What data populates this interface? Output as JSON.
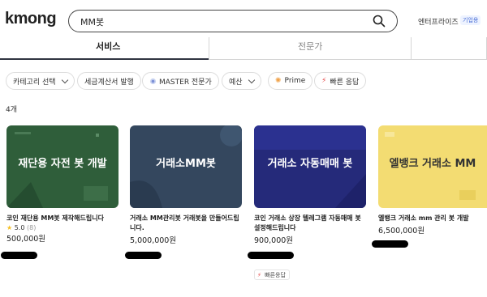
{
  "header": {
    "logo": "kmong",
    "search_value": "MM봇",
    "enterprise_label": "엔터프라이즈",
    "enterprise_badge": "기업용"
  },
  "tabs": [
    {
      "label": "서비스",
      "active": true
    },
    {
      "label": "전문가",
      "active": false
    }
  ],
  "filters": [
    {
      "label": "카테고리 선택",
      "icon": "",
      "dropdown": true
    },
    {
      "label": "세금계산서 발행",
      "icon": "",
      "dropdown": false
    },
    {
      "label": "MASTER 전문가",
      "icon": "master-icon",
      "dropdown": false
    },
    {
      "label": "예산",
      "icon": "",
      "dropdown": true
    },
    {
      "label": "Prime",
      "icon": "prime-icon",
      "dropdown": false
    },
    {
      "label": "빠른 응답",
      "icon": "lightning-icon",
      "dropdown": false
    }
  ],
  "result_count": "4개",
  "cards": [
    {
      "thumb_text": "재단용 자전 봇 개발",
      "title": "코인 재단용 MM봇 제작해드립니다",
      "rating": "5.0",
      "reviews": "(8)",
      "price": "500,000원",
      "bg": "#2f5e3a"
    },
    {
      "thumb_text": "거래소MM봇",
      "title": "거래소 MM관리봇 거래봇을 만들어드립니다.",
      "price": "5,000,000원",
      "bg": "#34475e"
    },
    {
      "thumb_text": "거래소 자동매매 봇",
      "title": "코인 거래소 상장 텔레그램 자동매매 봇 설정해드립니다",
      "price": "900,000원",
      "badge": "빠른응답",
      "bg": "#252a7a"
    },
    {
      "thumb_text": "엘뱅크 거래소 MM",
      "title": "엘뱅크 거래소 mm 관리 봇 개발",
      "price": "6,500,000원",
      "bg": "#f3dc72"
    }
  ],
  "colors": {
    "accent": "#303441",
    "star": "#f5c024",
    "fast": "#e64545"
  }
}
